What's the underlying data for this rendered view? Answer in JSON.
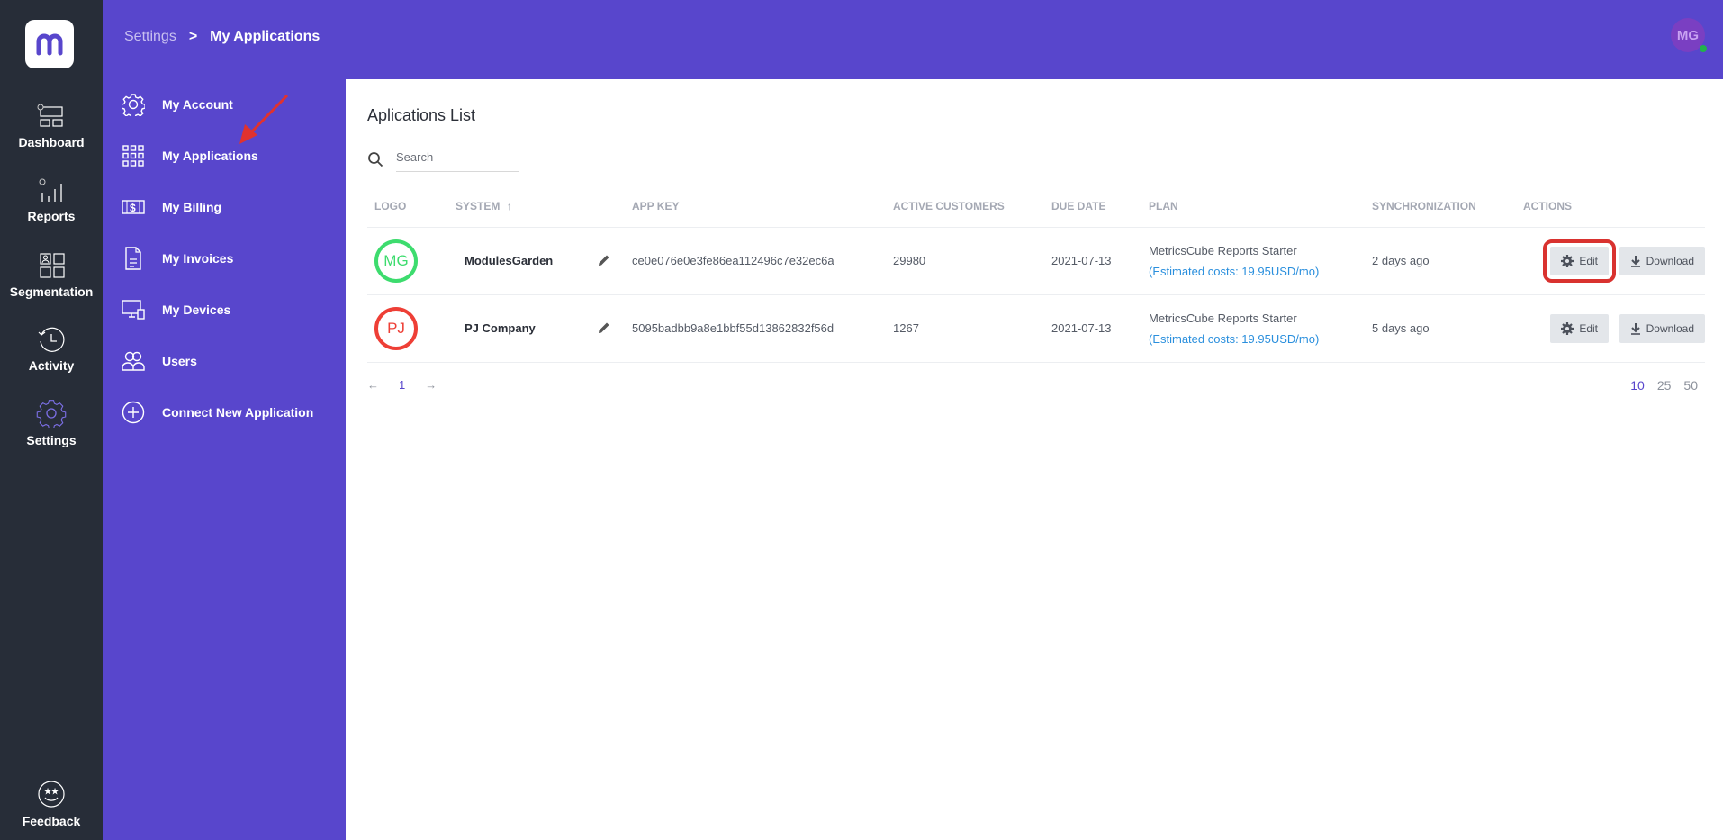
{
  "rail": {
    "items": [
      {
        "label": "Dashboard",
        "icon": "dashboard-icon"
      },
      {
        "label": "Reports",
        "icon": "reports-icon"
      },
      {
        "label": "Segmentation",
        "icon": "segmentation-icon"
      },
      {
        "label": "Activity",
        "icon": "activity-icon"
      },
      {
        "label": "Settings",
        "icon": "settings-icon"
      }
    ],
    "feedback": "Feedback"
  },
  "header": {
    "breadcrumb": [
      "Settings",
      "My Applications"
    ],
    "separator": ">",
    "avatar_initials": "MG"
  },
  "subnav": {
    "items": [
      {
        "label": "My Account",
        "icon": "gear-icon"
      },
      {
        "label": "My Applications",
        "icon": "grid-icon"
      },
      {
        "label": "My Billing",
        "icon": "billing-icon"
      },
      {
        "label": "My Invoices",
        "icon": "invoice-icon"
      },
      {
        "label": "My Devices",
        "icon": "devices-icon"
      },
      {
        "label": "Users",
        "icon": "users-icon"
      },
      {
        "label": "Connect New Application",
        "icon": "plus-circle-icon"
      }
    ]
  },
  "main": {
    "title": "Aplications List",
    "search_placeholder": "Search",
    "columns": [
      "LOGO",
      "SYSTEM",
      "APP KEY",
      "ACTIVE CUSTOMERS",
      "DUE DATE",
      "PLAN",
      "SYNCHRONIZATION",
      "ACTIONS"
    ],
    "sort_indicator": "↑",
    "rows": [
      {
        "initials": "MG",
        "color": "#3ddc6e",
        "system": "ModulesGarden",
        "app_key": "ce0e076e0e3fe86ea112496c7e32ec6a",
        "active_customers": "29980",
        "due_date": "2021-07-13",
        "plan": "MetricsCube Reports Starter",
        "plan_cost": "(Estimated costs: 19.95USD/mo)",
        "sync": "2 days ago",
        "edit": "Edit",
        "download": "Download"
      },
      {
        "initials": "PJ",
        "color": "#ee3f36",
        "system": "PJ Company",
        "app_key": "5095badbb9a8e1bbf55d13862832f56d",
        "active_customers": "1267",
        "due_date": "2021-07-13",
        "plan": "MetricsCube Reports Starter",
        "plan_cost": "(Estimated costs: 19.95USD/mo)",
        "sync": "5 days ago",
        "edit": "Edit",
        "download": "Download"
      }
    ],
    "pagination": {
      "prev": "←",
      "page": "1",
      "next": "→"
    },
    "per_page": [
      "10",
      "25",
      "50"
    ]
  }
}
